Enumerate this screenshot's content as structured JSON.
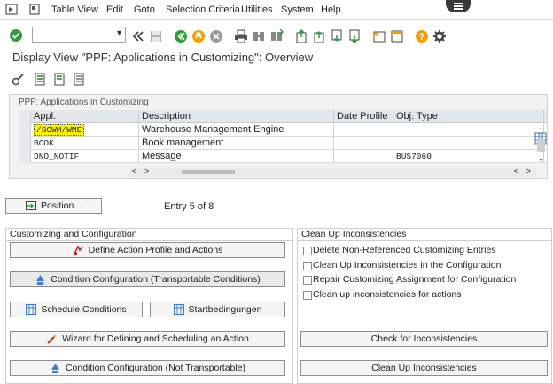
{
  "menubar": {
    "items": [
      "Table View",
      "Edit",
      "Goto",
      "Selection Criteria",
      "Utilities",
      "System",
      "Help"
    ]
  },
  "toolbar": {
    "command_value": "",
    "icons": [
      "enter-icon",
      "command-dropdown",
      "back-icon",
      "save-icon",
      "back-green-icon",
      "exit-icon",
      "cancel-icon",
      "print-icon",
      "find-icon",
      "find-next-icon",
      "first-page-icon",
      "previous-page-icon",
      "next-page-icon",
      "last-page-icon",
      "create-session-icon",
      "shortcut-icon",
      "help-icon",
      "customize-icon"
    ]
  },
  "page": {
    "title": "Display View \"PPF: Applications in Customizing\": Overview"
  },
  "table": {
    "title": "PPF: Applications in Customizing",
    "columns": [
      "Appl.",
      "Description",
      "Date Profile",
      "Obj. Type"
    ],
    "rows": [
      {
        "appl": "/SCWM/WME",
        "desc": "Warehouse Management Engine",
        "date_profile": "",
        "obj_type": ""
      },
      {
        "appl": "BOOK",
        "desc": "Book management",
        "date_profile": "",
        "obj_type": ""
      },
      {
        "appl": "DNO_NOTIF",
        "desc": "Message",
        "date_profile": "",
        "obj_type": "BUS7060"
      }
    ]
  },
  "position": {
    "button_label": "Position...",
    "entry_text": "Entry 5 of 8"
  },
  "customizing": {
    "title": "Customizing and Configuration",
    "define_action_profile": "Define Action Profile and Actions",
    "condition_config_transportable": "Condition Configuration (Transportable Conditions)",
    "schedule_conditions": "Schedule Conditions",
    "start_conditions": "Startbedingungen",
    "wizard": "Wizard for Defining and Scheduling an Action",
    "condition_config_not_transportable": "Condition Configuration (Not Transportable)"
  },
  "cleanup": {
    "title": "Clean Up Inconsistencies",
    "options": [
      "Delete Non-Referenced Customizing Entries",
      "Clean Up Inconsistencies in the Configuration",
      "Repair Customizing Assignment for Configuration",
      "Clean up inconsistencies for actions"
    ],
    "check_button": "Check for Inconsistencies",
    "cleanup_button": "Clean Up Inconsistencies"
  },
  "colors": {
    "green": "#2e9e3a",
    "orange": "#f0a000",
    "highlight": "#fff200"
  }
}
